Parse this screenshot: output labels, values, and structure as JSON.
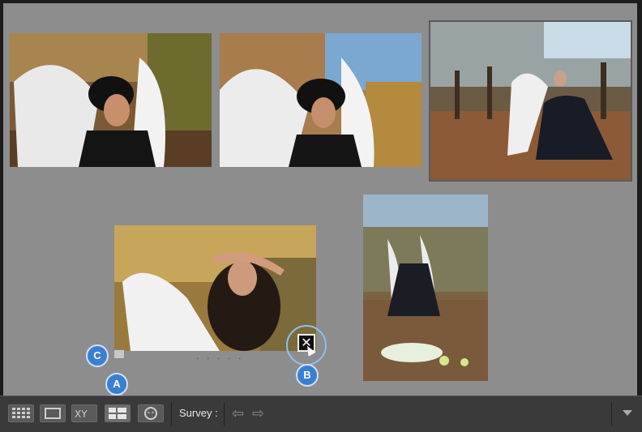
{
  "toolbar": {
    "view_buttons": [
      {
        "name": "grid-view-button",
        "icon": "grid-icon"
      },
      {
        "name": "loupe-view-button",
        "icon": "loupe-icon"
      },
      {
        "name": "compare-view-button",
        "icon": "compare-icon",
        "label": "XY"
      },
      {
        "name": "survey-view-button",
        "icon": "survey-icon"
      },
      {
        "name": "people-view-button",
        "icon": "people-icon"
      }
    ],
    "mode_label": "Survey :",
    "prev_arrow": "⇦",
    "next_arrow": "⇨"
  },
  "callouts": {
    "a": "A",
    "b": "B",
    "c": "C"
  },
  "reject_icon_glyph": "✕",
  "rating_dots": "· · · · ·",
  "colors": {
    "background": "#8d8d8d",
    "toolbar": "#3a3a3a",
    "callout": "#3b7fd1"
  }
}
